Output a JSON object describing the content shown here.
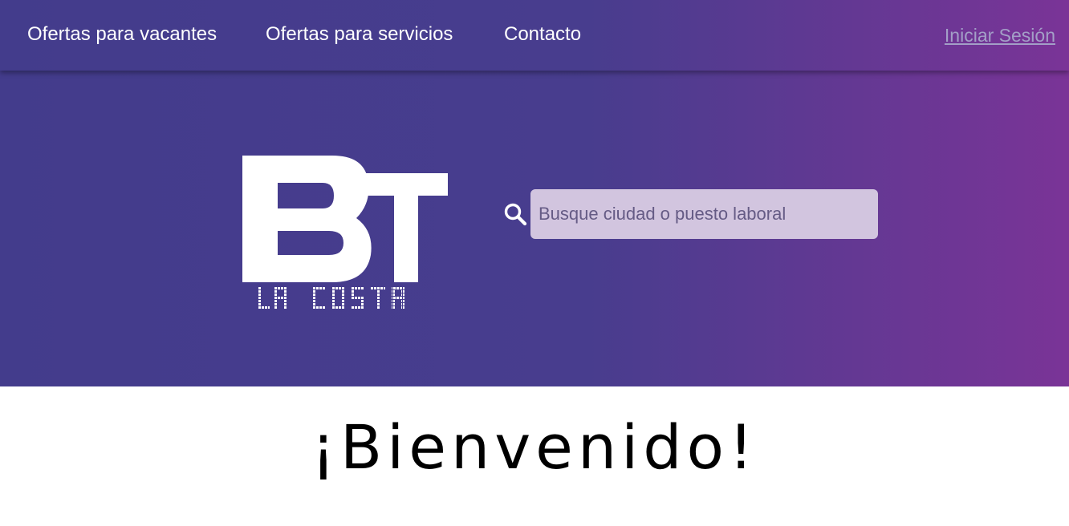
{
  "colors": {
    "gradient_start": "#433c8c",
    "gradient_end": "#7a3497",
    "nav_text": "#ffffff",
    "login_text": "#a39fc7",
    "search_bg": "#d2c5df"
  },
  "navbar": {
    "links": [
      {
        "label": "Ofertas para vacantes"
      },
      {
        "label": "Ofertas para servicios"
      },
      {
        "label": "Contacto"
      }
    ],
    "login_label": "Iniciar Sesión"
  },
  "hero": {
    "logo": {
      "letters": "BT",
      "tagline": "LA COSTA"
    },
    "search": {
      "icon": "search-icon",
      "placeholder": "Busque ciudad o puesto laboral",
      "value": ""
    }
  },
  "main": {
    "welcome_title": "¡Bienvenido!"
  }
}
